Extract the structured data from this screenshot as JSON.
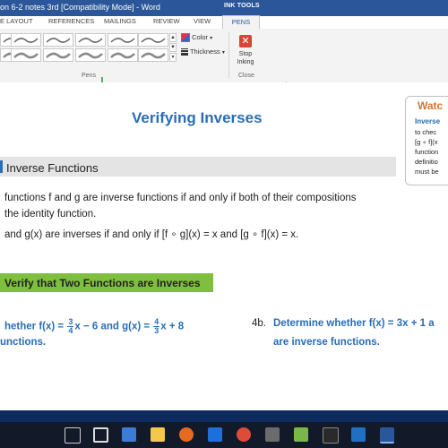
{
  "window": {
    "title": "on 6-2 notes 3rd [Compatibility Mode] - Word",
    "contextual_tab_group": "INK TOOLS"
  },
  "tabs": [
    "E LAYOUT",
    "REFERENCES",
    "MAILINGS",
    "REVIEW",
    "VIEW",
    "PENS"
  ],
  "ribbon": {
    "color_label": "Color",
    "thickness_label": "Thickness",
    "stop_inking_line1": "Stop",
    "stop_inking_line2": "Inking",
    "group_pens": "Pens",
    "group_close": "Close"
  },
  "document": {
    "heading": "Verifying Inverses",
    "section_title": "Inverse Functions",
    "para_line1": "functions f and g are inverse functions if and only if both of their compositions",
    "para_line2": "the identity function.",
    "para_line3": "and g(x) are inverses if and only if [f ∘ g](x) = x and [g ∘ f](x) = x.",
    "example_title": "Verify that Two Functions are Inverses",
    "ex4a": {
      "prefix": "hether f(x) = ",
      "frac1_num": "3",
      "frac1_den": "4",
      "middle": "x − 6 and g(x) = ",
      "frac2_num": "4",
      "frac2_den": "3",
      "suffix": "x + 8",
      "line2": "unctions."
    },
    "ex4b": {
      "number": "4b.",
      "line1": "Determine whether f(x) = 3x + 1 a",
      "line2": "are inverse functions."
    }
  },
  "watch_box": {
    "title": "Watc",
    "subtitle": "Inverse",
    "lines": [
      "to chec",
      "[g ∘ f](x",
      "function",
      "definitio",
      "must be"
    ]
  },
  "colors": {
    "titlebar": "#2b579a",
    "heading": "#2a6db5",
    "example_bar": "#7fbf3f",
    "watch_title": "#d9722b",
    "taskbar": "#0f2a5c"
  }
}
